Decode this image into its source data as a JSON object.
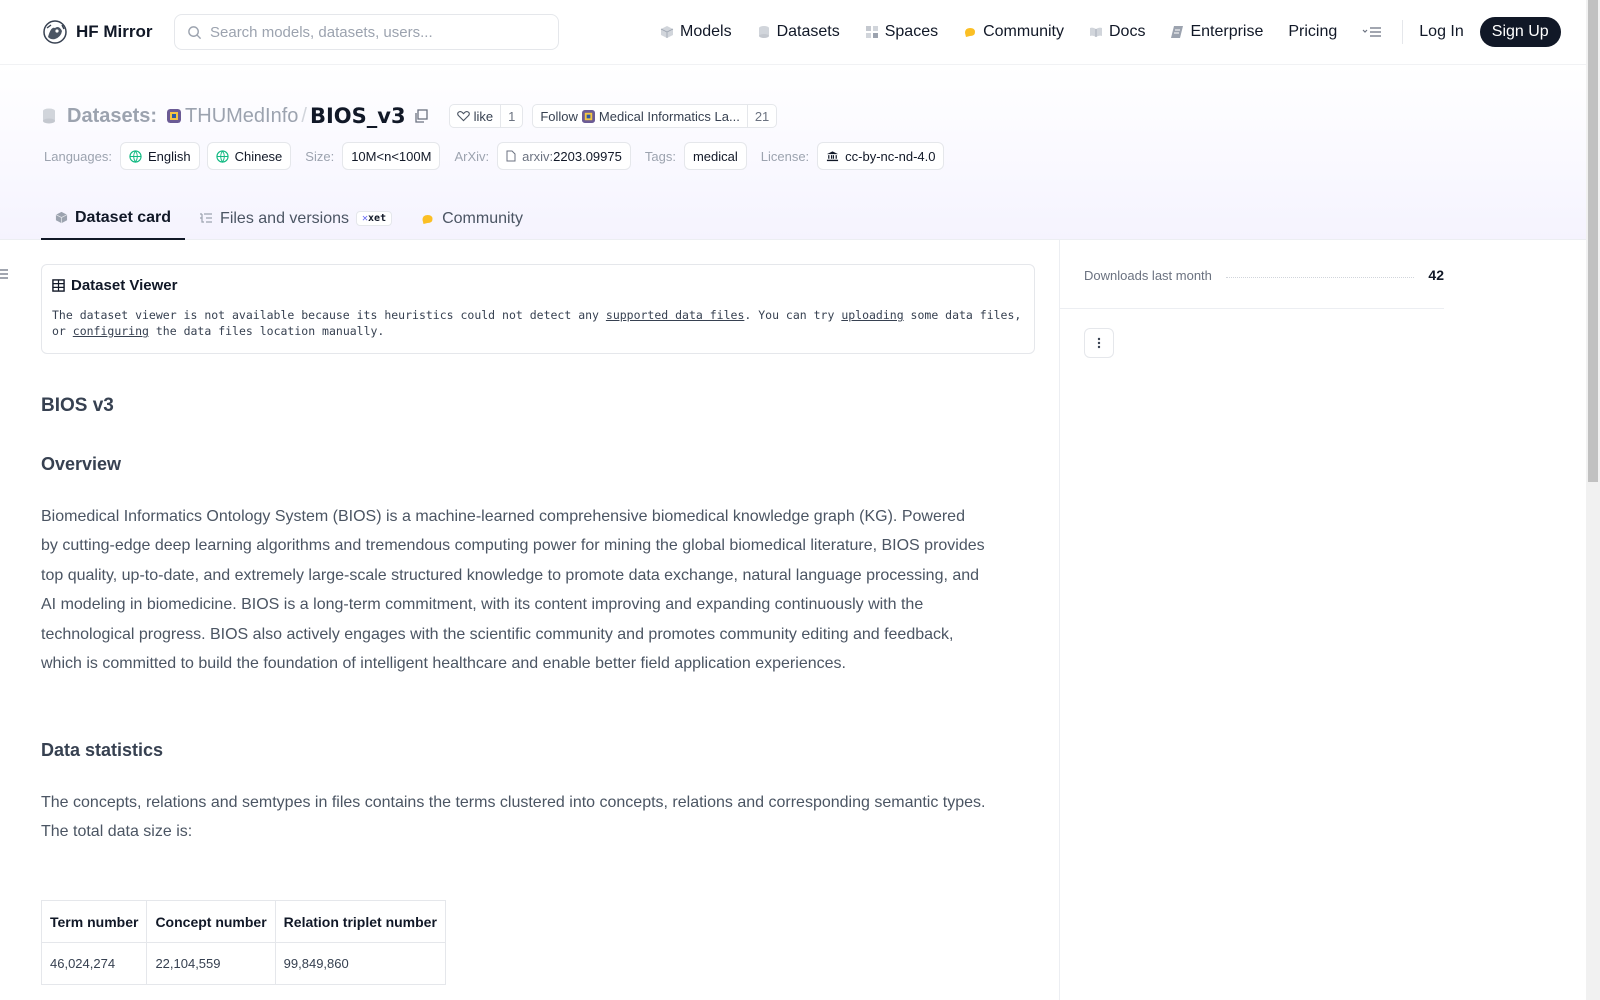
{
  "header": {
    "brand": "HF Mirror",
    "search_placeholder": "Search models, datasets, users...",
    "nav": [
      {
        "label": "Models",
        "icon": "models-icon"
      },
      {
        "label": "Datasets",
        "icon": "datasets-icon"
      },
      {
        "label": "Spaces",
        "icon": "spaces-icon"
      },
      {
        "label": "Community",
        "icon": "community-icon"
      },
      {
        "label": "Docs",
        "icon": "docs-icon"
      },
      {
        "label": "Enterprise",
        "icon": "enterprise-icon"
      },
      {
        "label": "Pricing"
      }
    ],
    "login": "Log In",
    "signup": "Sign Up"
  },
  "repo": {
    "type_label": "Datasets:",
    "org": "THUMedInfo",
    "separator": "/",
    "name": "BIOS_v3",
    "like_label": "like",
    "like_count": "1",
    "follow_label": "Follow",
    "follow_org": "Medical Informatics La...",
    "follow_count": "21"
  },
  "meta": {
    "languages_label": "Languages:",
    "languages": [
      "English",
      "Chinese"
    ],
    "size_label": "Size:",
    "size": "10M<n<100M",
    "arxiv_label": "ArXiv:",
    "arxiv_prefix": "arxiv:",
    "arxiv_id": "2203.09975",
    "tags_label": "Tags:",
    "tag": "medical",
    "license_label": "License:",
    "license": "cc-by-nc-nd-4.0"
  },
  "tabs": [
    {
      "label": "Dataset card",
      "active": true
    },
    {
      "label": "Files and versions",
      "badge": "xet"
    },
    {
      "label": "Community"
    }
  ],
  "viewer": {
    "title": "Dataset Viewer",
    "msg_1": "The dataset viewer is not available because its heuristics could not detect any ",
    "link_1": "supported data files",
    "msg_2": ". You can try ",
    "link_2": "uploading",
    "msg_3": " some data files, or ",
    "link_3": "configuring",
    "msg_4": " the data files location manually."
  },
  "card": {
    "title": "BIOS v3",
    "overview_heading": "Overview",
    "overview_text": "Biomedical Informatics Ontology System (BIOS) is a machine-learned comprehensive biomedical knowledge graph (KG). Powered by cutting-edge deep learning algorithms and tremendous computing power for mining the global biomedical literature, BIOS provides top quality, up-to-date, and extremely large-scale structured knowledge to promote data exchange, natural language processing, and AI modeling in biomedicine. BIOS is a long-term commitment, with its content improving and expanding continuously with the technological progress. BIOS also actively engages with the scientific community and promotes community editing and feedback, which is committed to build the foundation of intelligent healthcare and enable better field application experiences.",
    "stats_heading": "Data statistics",
    "stats_text": "The concepts, relations and semtypes in files contains the terms clustered into concepts, relations and corresponding semantic types. The total data size is:",
    "table": {
      "headers": [
        "Term number",
        "Concept number",
        "Relation triplet number"
      ],
      "rows": [
        [
          "46,024,274",
          "22,104,559",
          "99,849,860"
        ]
      ]
    }
  },
  "sidebar": {
    "downloads_label": "Downloads last month",
    "downloads_value": "42"
  },
  "colors": {
    "primary_dark": "#111827",
    "muted": "#9ca3af",
    "border": "#e5e7eb",
    "band_bg": "#f5f3fe"
  }
}
